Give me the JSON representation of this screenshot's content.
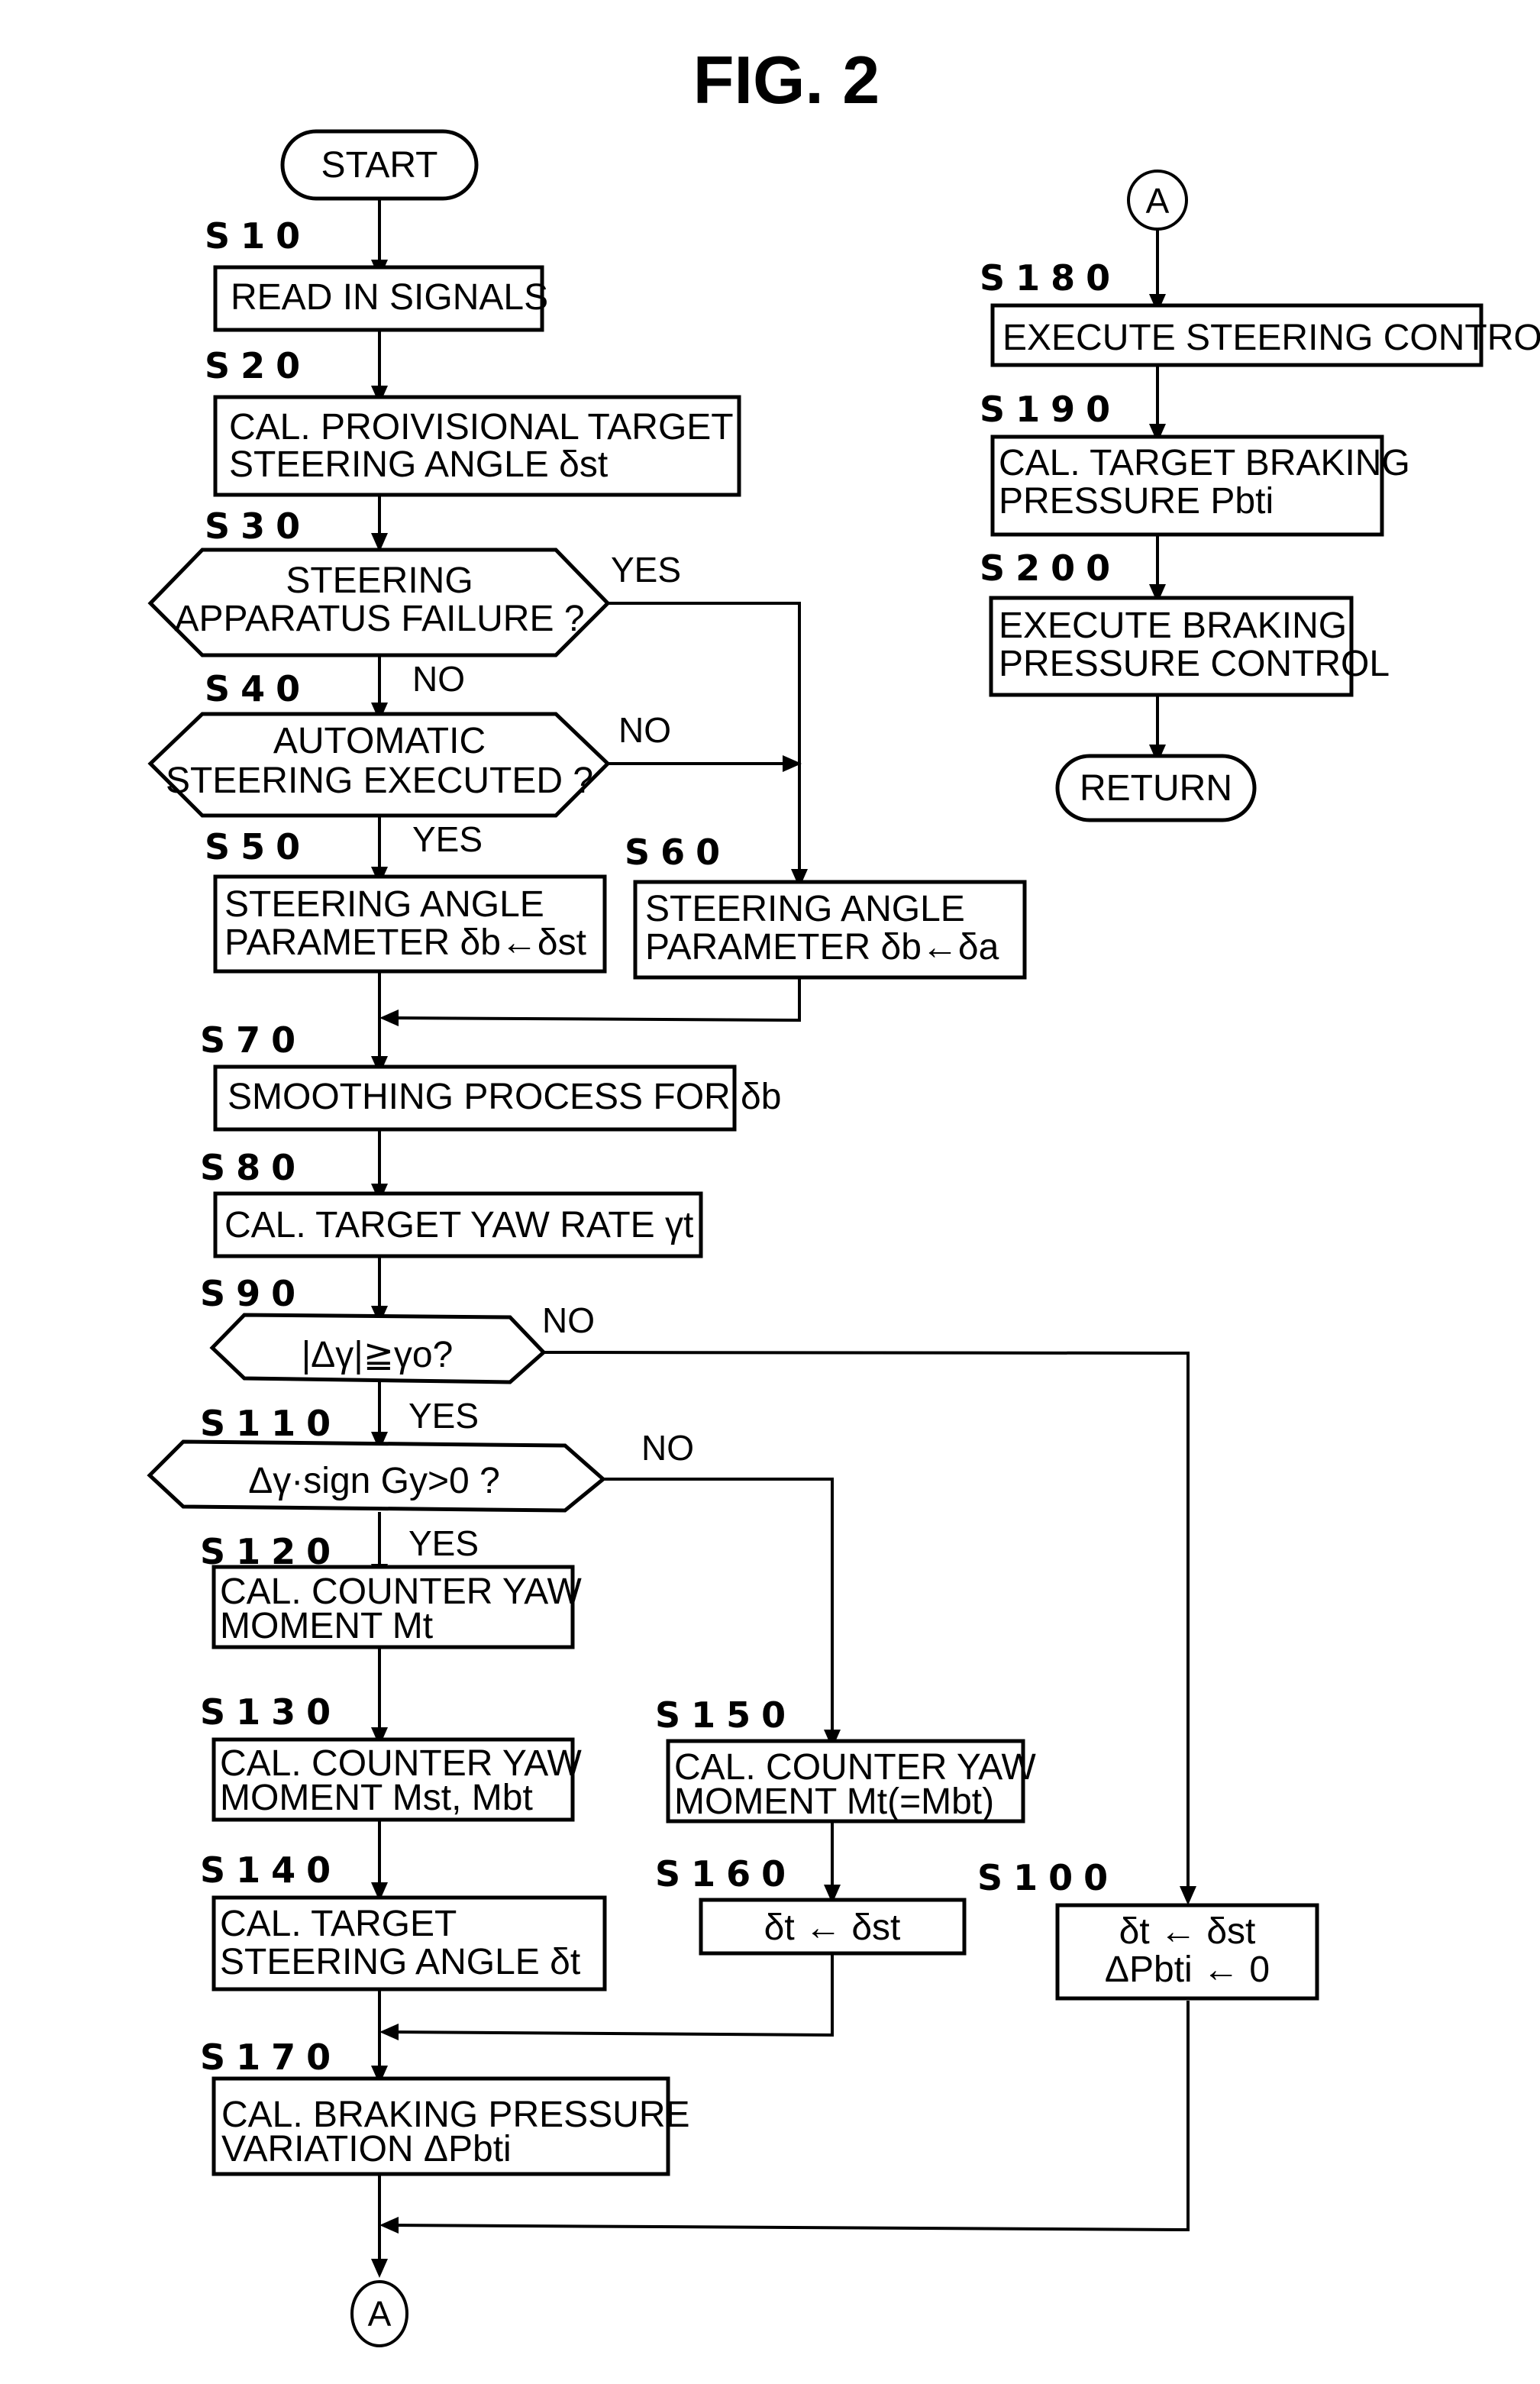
{
  "figure": {
    "title": "FIG. 2"
  },
  "terminals": {
    "start": "START",
    "return": "RETURN",
    "connector": "A"
  },
  "steps": {
    "s10": {
      "id": "S10",
      "lines": [
        "READ IN SIGNALS"
      ]
    },
    "s20": {
      "id": "S20",
      "lines": [
        "CAL. PROIVISIONAL TARGET",
        "STEERING ANGLE δst"
      ]
    },
    "s30": {
      "id": "S30",
      "lines": [
        "STEERING",
        "APPARATUS FAILURE ?"
      ]
    },
    "s40": {
      "id": "S40",
      "lines": [
        "AUTOMATIC",
        "STEERING EXECUTED ?"
      ]
    },
    "s50": {
      "id": "S50",
      "lines": [
        "STEERING ANGLE",
        "PARAMETER δb←δst"
      ]
    },
    "s60": {
      "id": "S60",
      "lines": [
        "STEERING ANGLE",
        "PARAMETER δb←δa"
      ]
    },
    "s70": {
      "id": "S70",
      "lines": [
        "SMOOTHING PROCESS FOR δb"
      ]
    },
    "s80": {
      "id": "S80",
      "lines": [
        "CAL. TARGET YAW RATE γt"
      ]
    },
    "s90": {
      "id": "S90",
      "lines": [
        "|Δγ|≧γo?"
      ]
    },
    "s100": {
      "id": "S100",
      "lines": [
        "δt ← δst",
        "ΔPbti ← 0"
      ]
    },
    "s110": {
      "id": "S110",
      "lines": [
        "Δγ·sign Gy>0 ?"
      ]
    },
    "s120": {
      "id": "S120",
      "lines": [
        "CAL. COUNTER YAW",
        "MOMENT Mt"
      ]
    },
    "s130": {
      "id": "S130",
      "lines": [
        "CAL. COUNTER YAW",
        "MOMENT Mst, Mbt"
      ]
    },
    "s140": {
      "id": "S140",
      "lines": [
        "CAL. TARGET",
        "STEERING ANGLE δt"
      ]
    },
    "s150": {
      "id": "S150",
      "lines": [
        "CAL. COUNTER YAW",
        "MOMENT Mt(=Mbt)"
      ]
    },
    "s160": {
      "id": "S160",
      "lines": [
        "δt ← δst"
      ]
    },
    "s170": {
      "id": "S170",
      "lines": [
        "CAL. BRAKING PRESSURE",
        "VARIATION ΔPbti"
      ]
    },
    "s180": {
      "id": "S180",
      "lines": [
        "EXECUTE STEERING CONTROL"
      ]
    },
    "s190": {
      "id": "S190",
      "lines": [
        "CAL. TARGET BRAKING",
        "PRESSURE Pbti"
      ]
    },
    "s200": {
      "id": "S200",
      "lines": [
        "EXECUTE BRAKING",
        "PRESSURE CONTROL"
      ]
    }
  },
  "branch_labels": {
    "yes": "YES",
    "no": "NO"
  }
}
